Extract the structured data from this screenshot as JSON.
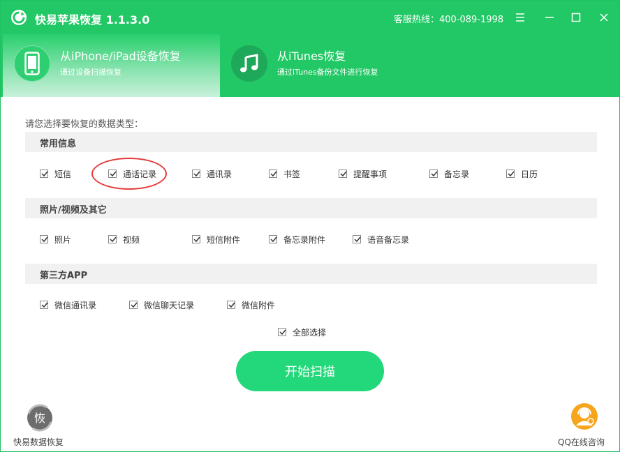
{
  "app": {
    "title": "快易苹果恢复 1.1.3.0",
    "hotline": "客服热线：400-089-1998"
  },
  "modes": [
    {
      "title": "从iPhone/iPad设备恢复",
      "subtitle": "通过设备扫描恢复",
      "icon": "phone-icon",
      "active": true
    },
    {
      "title": "从iTunes恢复",
      "subtitle": "通过iTunes备份文件进行恢复",
      "icon": "music-note-icon",
      "active": false
    }
  ],
  "prompt": "请您选择要恢复的数据类型：",
  "sections": [
    {
      "title": "常用信息",
      "items": [
        "短信",
        "通话记录",
        "通讯录",
        "书签",
        "提醒事项",
        "备忘录",
        "日历"
      ]
    },
    {
      "title": "照片/视频及其它",
      "items": [
        "照片",
        "视频",
        "短信附件",
        "备忘录附件",
        "语音备忘录"
      ]
    },
    {
      "title": "第三方APP",
      "items": [
        "微信通讯录",
        "微信聊天记录",
        "微信附件"
      ]
    }
  ],
  "select_all": "全部选择",
  "start_button": "开始扫描",
  "footer": {
    "left_label": "快易数据恢复",
    "left_badge_char": "恢",
    "right_label": "QQ在线咨询"
  },
  "colors": {
    "brand_green": "#22c865",
    "button_green": "#22d87a",
    "annotation_red": "#e53a3a"
  }
}
